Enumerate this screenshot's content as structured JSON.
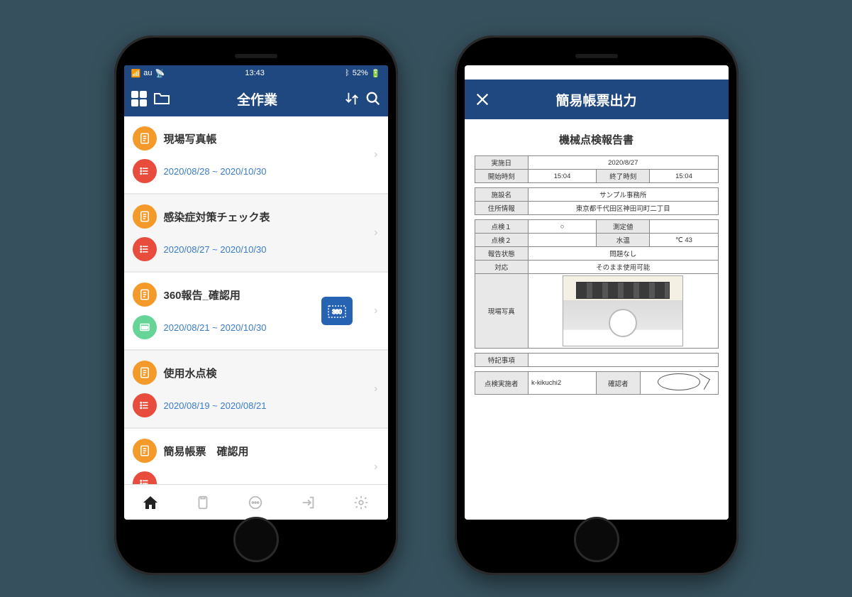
{
  "phone1": {
    "status": {
      "carrier": "au",
      "time": "13:43",
      "battery": "52%"
    },
    "nav": {
      "title": "全作業"
    },
    "rows": [
      {
        "title": "現場写真帳",
        "date": "2020/08/28 ~ 2020/10/30",
        "topColor": "c-orange",
        "botColor": "c-red"
      },
      {
        "title": "感染症対策チェック表",
        "date": "2020/08/27 ~ 2020/10/30",
        "topColor": "c-orange",
        "botColor": "c-red"
      },
      {
        "title": "360報告_確認用",
        "date": "2020/08/21 ~ 2020/10/30",
        "topColor": "c-orange",
        "botColor": "c-green",
        "badge": "360"
      },
      {
        "title": "使用水点検",
        "date": "2020/08/19 ~ 2020/08/21",
        "topColor": "c-orange",
        "botColor": "c-red"
      },
      {
        "title": "簡易帳票　確認用",
        "date": "",
        "topColor": "c-orange",
        "botColor": "c-red"
      }
    ]
  },
  "phone2": {
    "nav": {
      "title": "簡易帳票出力"
    },
    "report": {
      "title": "機械点検報告書",
      "date_label": "実施日",
      "date": "2020/8/27",
      "start_label": "開始時刻",
      "start": "15:04",
      "end_label": "終了時刻",
      "end": "15:04",
      "facility_label": "施設名",
      "facility": "サンプル事務所",
      "address_label": "住所情報",
      "address": "東京都千代田区神田司町二丁目",
      "check1_label": "点検１",
      "check1": "○",
      "measure_label": "測定値",
      "measure": "",
      "check2_label": "点検２",
      "check2": "",
      "water_label": "水温",
      "water": "℃ 43",
      "status_label": "報告状態",
      "status": "問題なし",
      "action_label": "対応",
      "action": "そのまま使用可能",
      "photo_label": "現場写真",
      "notes_label": "特記事項",
      "notes": "",
      "inspector_label": "点検実施者",
      "inspector": "k-kikuchi2",
      "verifier_label": "確認者"
    }
  }
}
